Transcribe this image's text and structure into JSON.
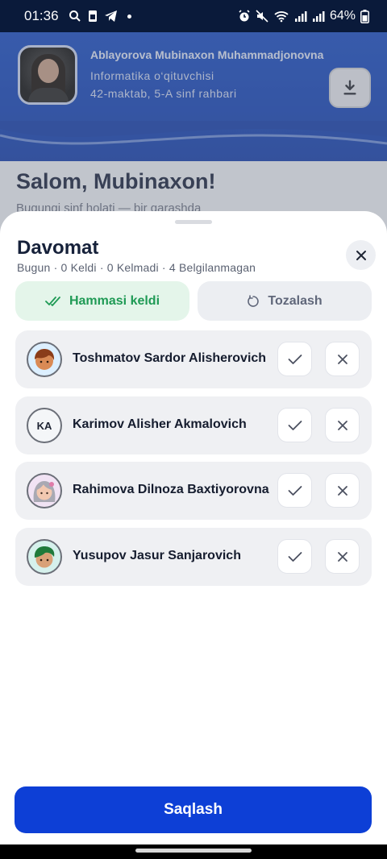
{
  "status_bar": {
    "time": "01:36",
    "battery": "64%",
    "left_icons": [
      "search-icon",
      "sim-icon",
      "telegram-icon",
      "dot-icon"
    ],
    "right_icons": [
      "alarm-icon",
      "mute-icon",
      "wifi-icon",
      "signal-icon",
      "signal-icon",
      "battery-icon"
    ]
  },
  "background": {
    "teacher_name": "Ablayorova Mubinaxon Muhammadjonovna",
    "teacher_role": "Informatika o‘qituvchisi",
    "teacher_school": "42-maktab, 5-A sinf rahbari",
    "greeting": "Salom, Mubinaxon!",
    "greeting_sub": "Bugungi sinf holati — bir qarashda"
  },
  "sheet": {
    "title": "Davomat",
    "summary": "Bugun · 0 Keldi · 0 Kelmadi · 4 Belgilanmagan",
    "all_present_label": "Hammasi keldi",
    "clear_label": "Tozalash",
    "save_label": "Saqlash",
    "students": [
      {
        "name": "Toshmatov Sardor Alisherovich",
        "avatar": "boy-avatar-brown",
        "initials": ""
      },
      {
        "name": "Karimov Alisher Akmalovich",
        "avatar": "initials",
        "initials": "KA"
      },
      {
        "name": "Rahimova Dilnoza Baxtiyorovna",
        "avatar": "girl-avatar-gray",
        "initials": ""
      },
      {
        "name": "Yusupov Jasur Sanjarovich",
        "avatar": "boy-avatar-green",
        "initials": ""
      }
    ]
  },
  "colors": {
    "primary": "#0d3fd6",
    "hero": "#1c4fc4",
    "success": "#1f9a55",
    "success_bg": "#e4f5ea"
  }
}
